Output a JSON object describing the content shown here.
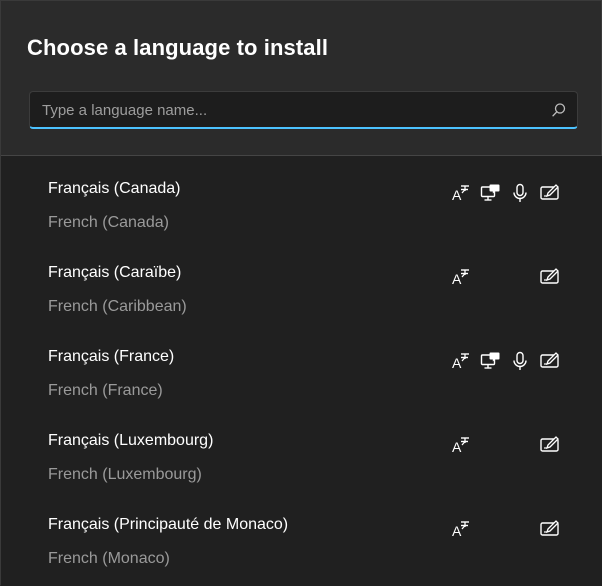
{
  "dialog": {
    "title": "Choose a language to install"
  },
  "search": {
    "placeholder": "Type a language name...",
    "value": "",
    "icon": "search-icon"
  },
  "features_legend": {
    "text": "text-to-speech-icon",
    "display": "display-language-icon",
    "speech": "speech-recognition-icon",
    "handwriting": "handwriting-icon"
  },
  "colors": {
    "accent": "#4cc2ff",
    "header_bg": "#2b2b2b",
    "list_bg": "#202020",
    "secondary_text": "#9a9a9a"
  },
  "languages": [
    {
      "native": "Français (Canada)",
      "english": "French (Canada)",
      "features": {
        "text": true,
        "display": true,
        "speech": true,
        "handwriting": true
      }
    },
    {
      "native": "Français (Caraïbe)",
      "english": "French (Caribbean)",
      "features": {
        "text": true,
        "display": false,
        "speech": false,
        "handwriting": true
      }
    },
    {
      "native": "Français (France)",
      "english": "French (France)",
      "features": {
        "text": true,
        "display": true,
        "speech": true,
        "handwriting": true
      }
    },
    {
      "native": "Français (Luxembourg)",
      "english": "French (Luxembourg)",
      "features": {
        "text": true,
        "display": false,
        "speech": false,
        "handwriting": true
      }
    },
    {
      "native": "Français (Principauté de Monaco)",
      "english": "French (Monaco)",
      "features": {
        "text": true,
        "display": false,
        "speech": false,
        "handwriting": true
      }
    }
  ]
}
